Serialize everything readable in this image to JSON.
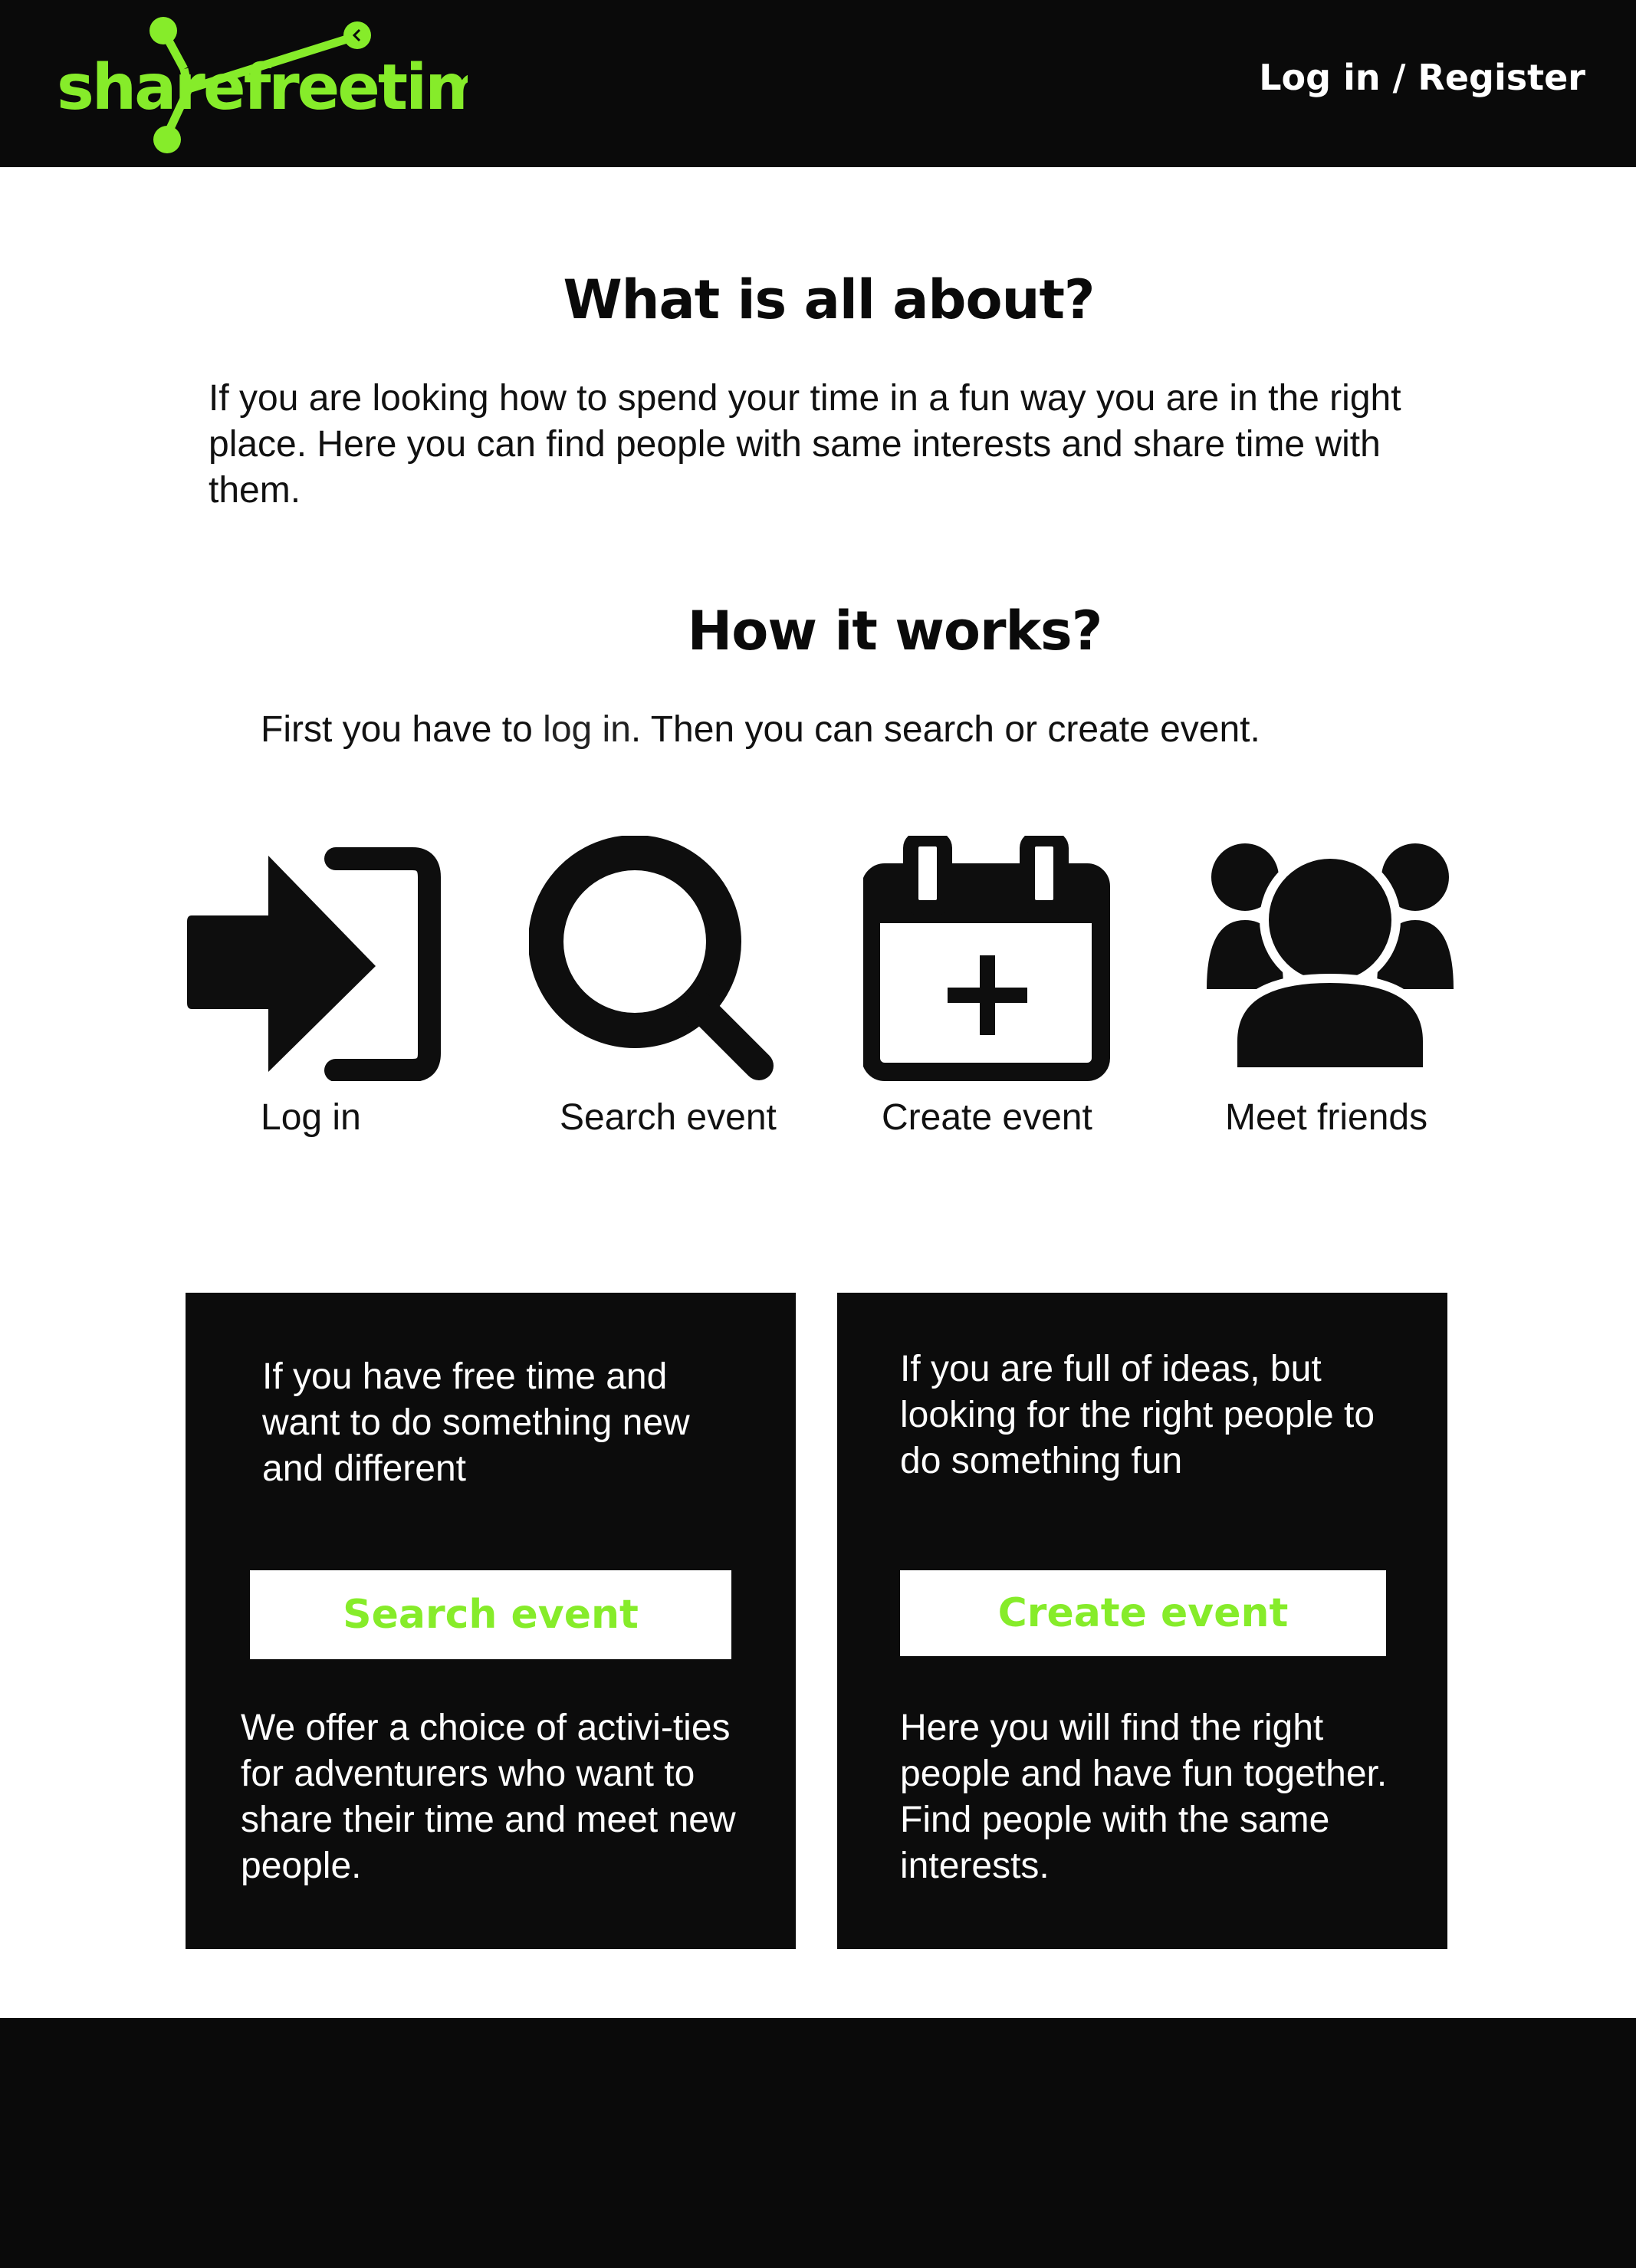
{
  "header": {
    "logo": {
      "text": "sharefreetime",
      "color": "#86ec2a"
    },
    "login_register_label": "Log in / Register"
  },
  "about": {
    "title": "What is all about?",
    "text": "If you are looking how to spend your time in a fun way you are in the right place. Here you can find people with same interests and share time with them."
  },
  "how": {
    "title": "How it works?",
    "text_before": "First you have to ",
    "link_text": "log in",
    "text_after": ". Then you can search or create event."
  },
  "steps": [
    {
      "icon": "login-icon",
      "label": "Log in"
    },
    {
      "icon": "search-icon",
      "label": "Search event"
    },
    {
      "icon": "calendar-add-icon",
      "label": "Create event"
    },
    {
      "icon": "people-group-icon",
      "label": "Meet friends"
    }
  ],
  "cards": [
    {
      "top_text": "If you have free time and want to do something new and different",
      "button_label": "Search event",
      "bottom_text": "We offer a choice of activi-ties for adventurers who want to share their time and meet new people."
    },
    {
      "top_text": "If you are full of ideas, but looking for the right people to do something fun",
      "button_label": "Create event",
      "bottom_text": "Here you will find the right people and have fun together. Find people with the same interests."
    }
  ],
  "colors": {
    "accent": "#86ec2a",
    "dark": "#0a0a0a",
    "background": "#ffffff"
  }
}
